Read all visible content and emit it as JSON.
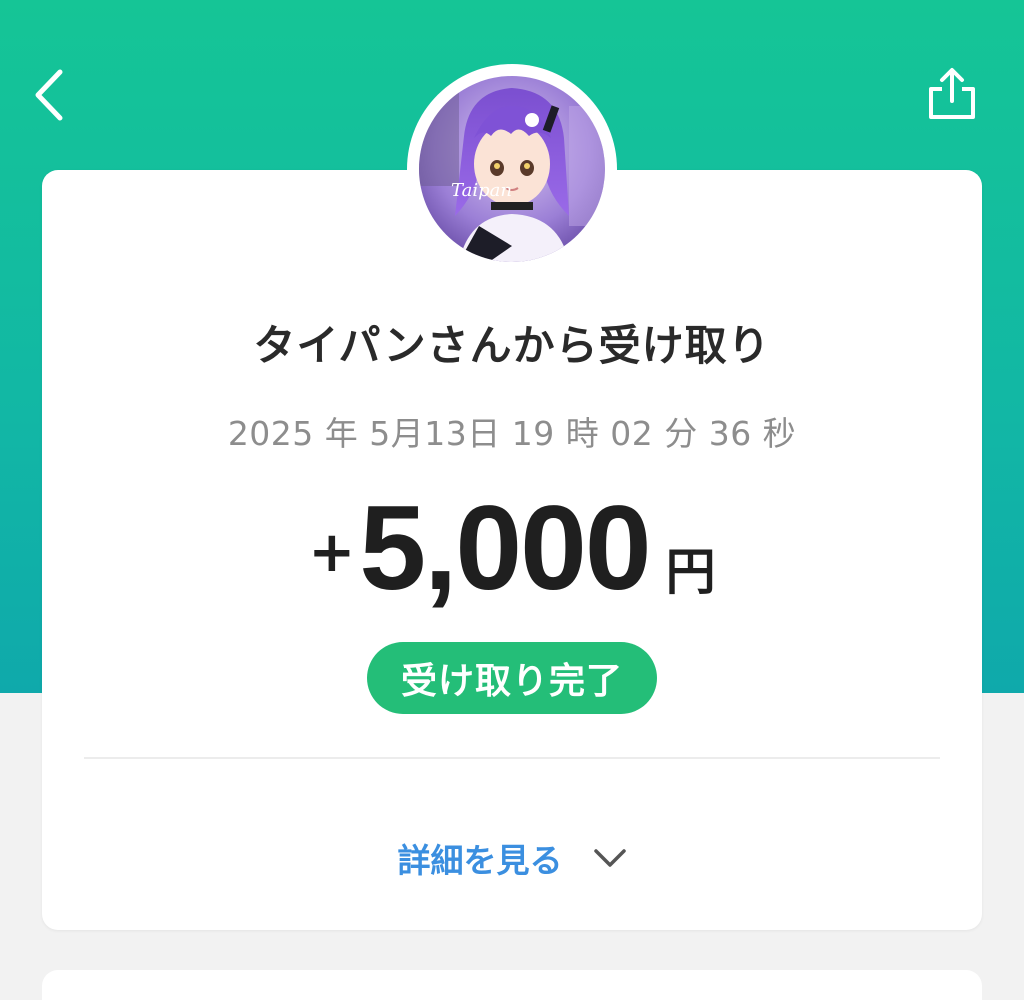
{
  "header": {
    "back_icon": "chevron-left-icon",
    "share_icon": "share-icon"
  },
  "sender": {
    "avatar_signature": "Taipan"
  },
  "transaction": {
    "title": "タイパンさんから受け取り",
    "datetime": "2025 年 5月13日 19 時 02 分 36 秒",
    "amount_sign": "+",
    "amount_value": "5,000",
    "amount_unit": "円",
    "status_label": "受け取り完了"
  },
  "details": {
    "label": "詳細を見る",
    "icon": "chevron-down-icon"
  },
  "colors": {
    "header_green_top": "#15c596",
    "header_teal_bottom": "#0fa9ab",
    "status_green": "#24be78",
    "link_blue": "#3b8fe0",
    "page_background": "#f2f2f2"
  }
}
